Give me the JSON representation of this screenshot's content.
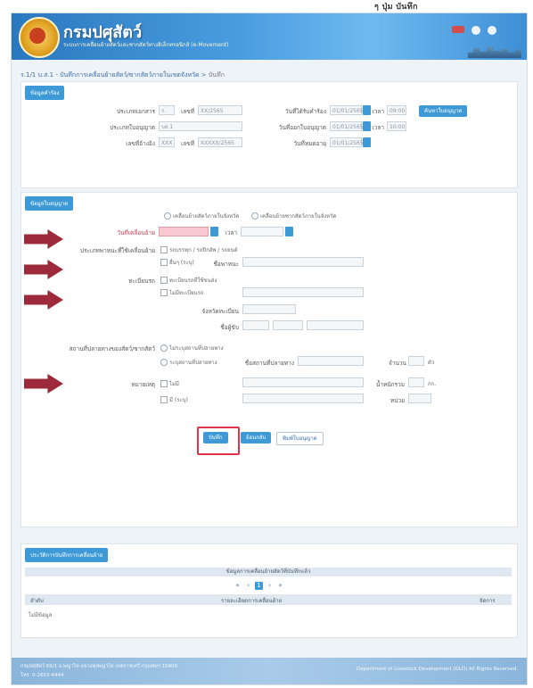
{
  "topcut": "ๆ ปุ่ม บันทึก",
  "header": {
    "brand": "กรมปศุสัตว์",
    "subtitle": "ระบบการเคลื่อนย้ายสัตว์และซากสัตว์ทางอิเล็กทรอนิกส์ (e-Movement)"
  },
  "breadcrumb": {
    "path": "ร.1/1 บ.ส.1 - บันทึกการเคลื่อนย้ายสัตว์/ซากสัตว์ภายในเขตจังหวัด",
    "current": "บันทึก"
  },
  "sections": {
    "request_tab": "ข้อมูลคำร้อง",
    "permit_tab": "ข้อมูลใบอนุญาต",
    "history_tab": "ประวัติการบันทึกการเคลื่อนย้าย"
  },
  "request_fields": {
    "doc_type_label": "ประเภทเอกสาร",
    "doc_type_a": "ร.",
    "doc_no_label": "เลขที่",
    "doc_no": "XX/2565",
    "permit_type_label": "ประเภทใบอนุญาต",
    "permit_type": "บส.1",
    "ref_no_label": "เลขที่อ้างอิง",
    "ref_no_a": "XXX",
    "ref_no_b": "XXXXX/2565",
    "date_from_label": "วันที่ได้รับคำร้อง",
    "date_from": "01/01/2565",
    "time_from_label": "เวลา",
    "time_from": "09:00",
    "date_req_label": "วันที่ออกใบอนุญาต",
    "date_req": "01/01/2565",
    "time_req_label": "เวลา",
    "time_req": "10:00",
    "date_exp_label": "วันที่หมดอายุ",
    "date_exp": "01/01/2565",
    "search_button": "ค้นหาใบอนุญาต"
  },
  "permit_fields": {
    "radio_one": "เคลื่อนย้ายสัตว์ภายในจังหวัด",
    "radio_two": "เคลื่อนย้ายซากสัตว์ภายในจังหวัด",
    "date_label": "วันที่เคลื่อนย้าย",
    "time_label": "เวลา",
    "vehicle_label": "ประเภทพาหนะที่ใช้เคลื่อนย้าย",
    "vehicle_opt1": "รถบรรทุก / รถปิกอัพ / รถยนต์",
    "vehicle_opt2": "อื่นๆ (ระบุ)",
    "vehicle_other_label": "ชื่อพาหนะ",
    "license_label": "ทะเบียนรถ",
    "license_opt1": "ทะเบียนรถที่ใช้ขนส่ง",
    "license_opt2": "ไม่มีทะเบียนรถ",
    "province_label": "จังหวัดทะเบียน",
    "driver_label": "ชื่อผู้ขับ",
    "dest_label": "สถานที่ปลายทางของสัตว์/ซากสัตว์",
    "dest_opt1": "ไม่ระบุสถานที่ปลายทาง",
    "dest_opt2": "ระบุสถานที่ปลายทาง",
    "dest_detail_label": "ชื่อสถานที่ปลายทาง",
    "amount_label": "จำนวน",
    "amount_unit": "ตัว",
    "other_label": "หมายเหตุ",
    "other_opt1": "ไม่มี",
    "other_opt2": "มี (ระบุ)",
    "weight_label": "น้ำหนักรวม",
    "weight_unit": "กก.",
    "unit_label": "หน่วย"
  },
  "actions": {
    "save": "บันทึก",
    "back": "ย้อนกลับ",
    "print": "พิมพ์ใบอนุญาต"
  },
  "table": {
    "title": "ข้อมูลการเคลื่อนย้ายสัตว์ที่บันทึกแล้ว",
    "col_no": "ลำดับ",
    "col_detail": "รายละเอียดการเคลื่อนย้าย",
    "col_manage": "จัดการ",
    "empty": "ไม่มีข้อมูล",
    "pages": [
      "«",
      "‹",
      "1",
      "›",
      "»"
    ],
    "page_active": "1"
  },
  "footer": {
    "left_line1": "กรมปศุสัตว์ 69/1 ถ.พญาไท แขวงทุ่งพญาไท เขตราชเทวี กรุงเทพฯ 10400",
    "left_line2": "โทร. 0-2653-4444",
    "right": "Department of Livestock Development (DLD) All Rights Reserved."
  },
  "colors": {
    "accent": "#3e9ad6",
    "header_start": "#2a78c0",
    "arrow": "#9c2a3a",
    "highlight": "#e0344c"
  }
}
